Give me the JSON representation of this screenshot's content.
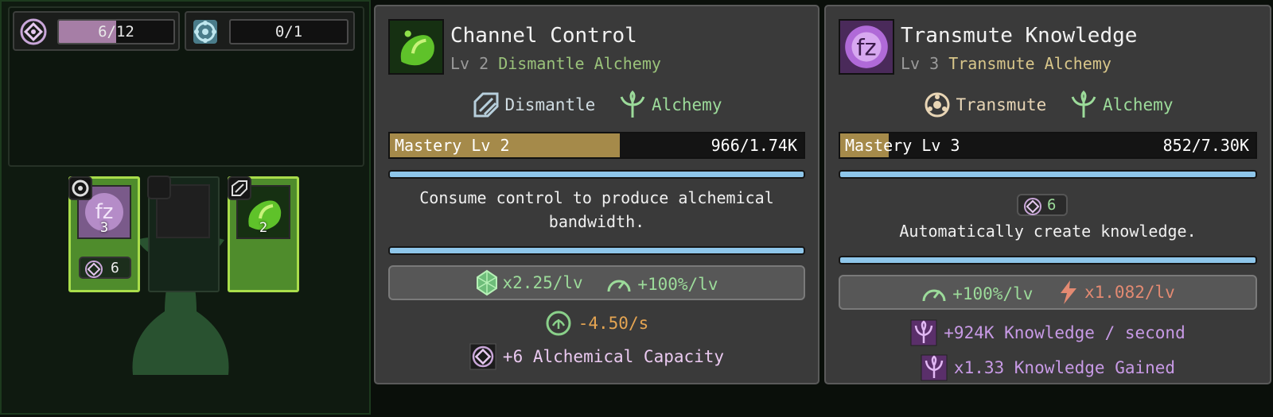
{
  "resources": {
    "alchemy": {
      "icon": "alchemy-rune-icon",
      "current": 6,
      "max": 12,
      "text": "6/12"
    },
    "transmute": {
      "icon": "transmute-rune-icon",
      "current": 0,
      "max": 1,
      "text": "0/1"
    }
  },
  "slots": [
    {
      "name": "Transmute Knowledge",
      "level": "3",
      "badge_icon": "transmute-icon",
      "cost": "6",
      "state": "active"
    },
    {
      "name": "",
      "level": "",
      "badge_icon": "",
      "cost": "",
      "state": "empty"
    },
    {
      "name": "Channel Control",
      "level": "2",
      "badge_icon": "dismantle-icon",
      "cost": "",
      "state": "active"
    }
  ],
  "card1": {
    "title": "Channel Control",
    "subtitle_level": "Lv 2",
    "subtitle_type": "Dismantle Alchemy",
    "tags": [
      "Dismantle",
      "Alchemy"
    ],
    "mastery_label": "Mastery Lv 2",
    "mastery_value": "966/1.74K",
    "mastery_progress": 0.555,
    "description": "Consume control to produce alchemical bandwidth.",
    "stat_a": "x2.25/lv",
    "stat_b": "+100%/lv",
    "drain": "-4.50/s",
    "capacity": "+6 Alchemical Capacity"
  },
  "card2": {
    "title": "Transmute Knowledge",
    "subtitle_level": "Lv 3",
    "subtitle_type": "Transmute Alchemy",
    "tags": [
      "Transmute",
      "Alchemy"
    ],
    "mastery_label": "Mastery Lv 3",
    "mastery_value": "852/7.30K",
    "mastery_progress": 0.117,
    "cost": "6",
    "description": "Automatically create knowledge.",
    "stat_a": "+100%/lv",
    "stat_b": "x1.082/lv",
    "knowledge_rate": "+924K Knowledge / second",
    "knowledge_gain": "x1.33 Knowledge Gained"
  },
  "colors": {
    "mastery_fill": "#a58a4a",
    "divider": "#8ec6ea",
    "slot_active": "#4f8c2c",
    "resource_fill": "#a67ea6"
  }
}
